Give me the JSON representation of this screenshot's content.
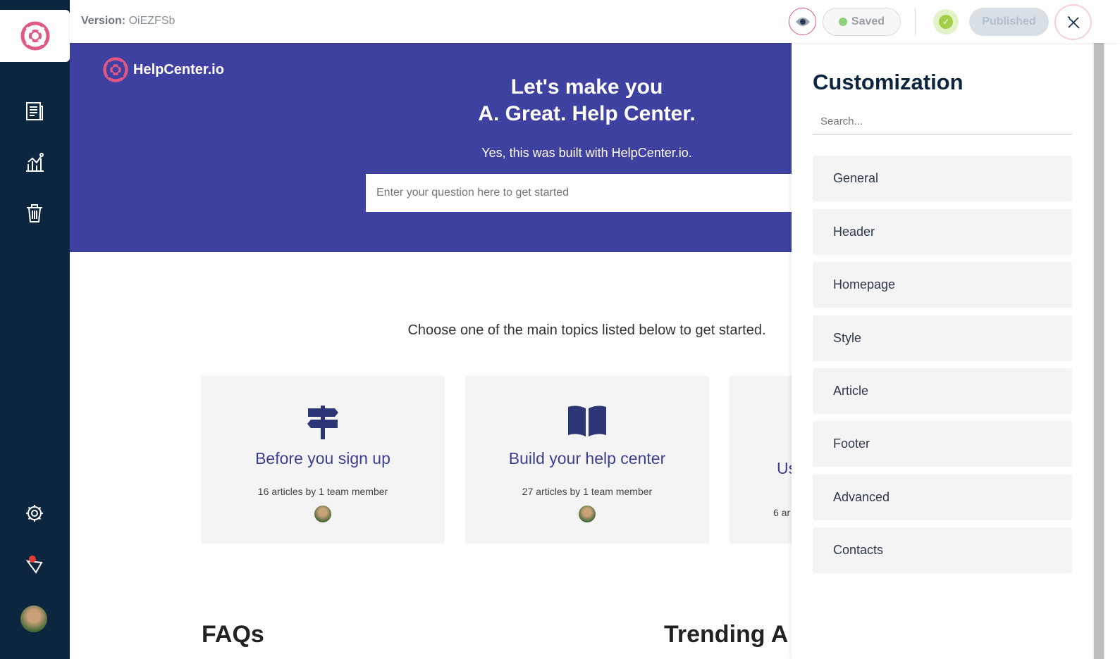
{
  "topbar": {
    "version_label": "Version:",
    "version_value": "OiEZFSb",
    "saved_label": "Saved",
    "published_label": "Published"
  },
  "sidebar": {
    "icons": [
      "lifebuoy-logo-icon",
      "articles-icon",
      "analytics-icon",
      "trash-icon",
      "settings-icon",
      "notifications-icon",
      "avatar"
    ]
  },
  "hero": {
    "brand": "HelpCenter.io",
    "title_line1": "Let's make you",
    "title_line2": "A. Great. Help Center.",
    "subtitle": "Yes, this was built with HelpCenter.io.",
    "search_placeholder": "Enter your question here to get started"
  },
  "main": {
    "intro": "Choose one of the main topics listed below to get started.",
    "cards": [
      {
        "title": "Before you sign up",
        "meta": "16 articles by 1 team member"
      },
      {
        "title": "Build your help center",
        "meta": "27 articles by 1 team member"
      },
      {
        "title": "Us",
        "meta": "6 ar"
      }
    ],
    "faqs_heading": "FAQs",
    "trending_heading": "Trending A"
  },
  "panel": {
    "title": "Customization",
    "search_placeholder": "Search...",
    "items": [
      "General",
      "Header",
      "Homepage",
      "Style",
      "Article",
      "Footer",
      "Advanced",
      "Contacts"
    ]
  },
  "colors": {
    "sidebar": "#0d2640",
    "hero": "#3f41a0",
    "brand_pink": "#e05783",
    "saved_green": "#8fd17b"
  }
}
